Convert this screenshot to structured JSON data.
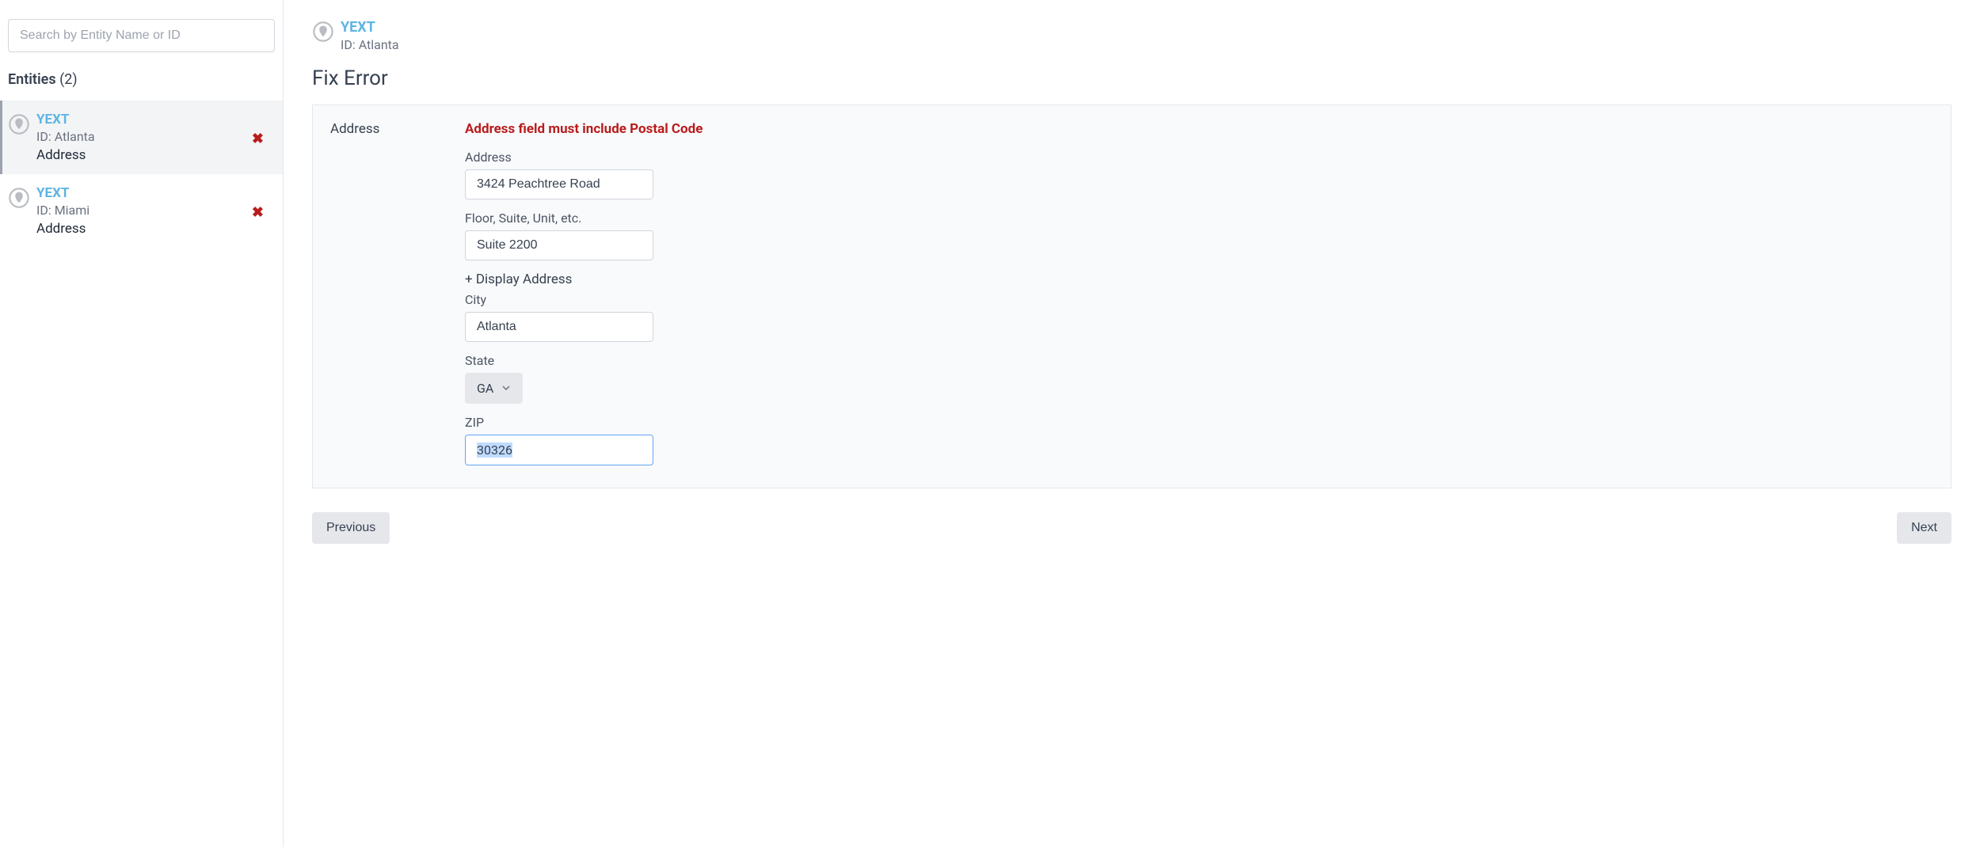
{
  "sidebar": {
    "search_placeholder": "Search by Entity Name or ID",
    "entities_label": "Entities",
    "entities_count": "(2)",
    "items": [
      {
        "name": "YEXT",
        "id_label": "ID: Atlanta",
        "field": "Address",
        "has_error": true,
        "active": true
      },
      {
        "name": "YEXT",
        "id_label": "ID: Miami",
        "field": "Address",
        "has_error": true,
        "active": false
      }
    ]
  },
  "header": {
    "name": "YEXT",
    "id_label": "ID: Atlanta"
  },
  "page_title": "Fix Error",
  "form": {
    "section_label": "Address",
    "error_message": "Address field must include Postal Code",
    "address_label": "Address",
    "address_value": "3424 Peachtree Road",
    "floor_label": "Floor, Suite, Unit, etc.",
    "floor_value": "Suite 2200",
    "display_address_link": "+ Display Address",
    "city_label": "City",
    "city_value": "Atlanta",
    "state_label": "State",
    "state_value": "GA",
    "zip_label": "ZIP",
    "zip_value": "30326"
  },
  "buttons": {
    "previous": "Previous",
    "next": "Next"
  }
}
